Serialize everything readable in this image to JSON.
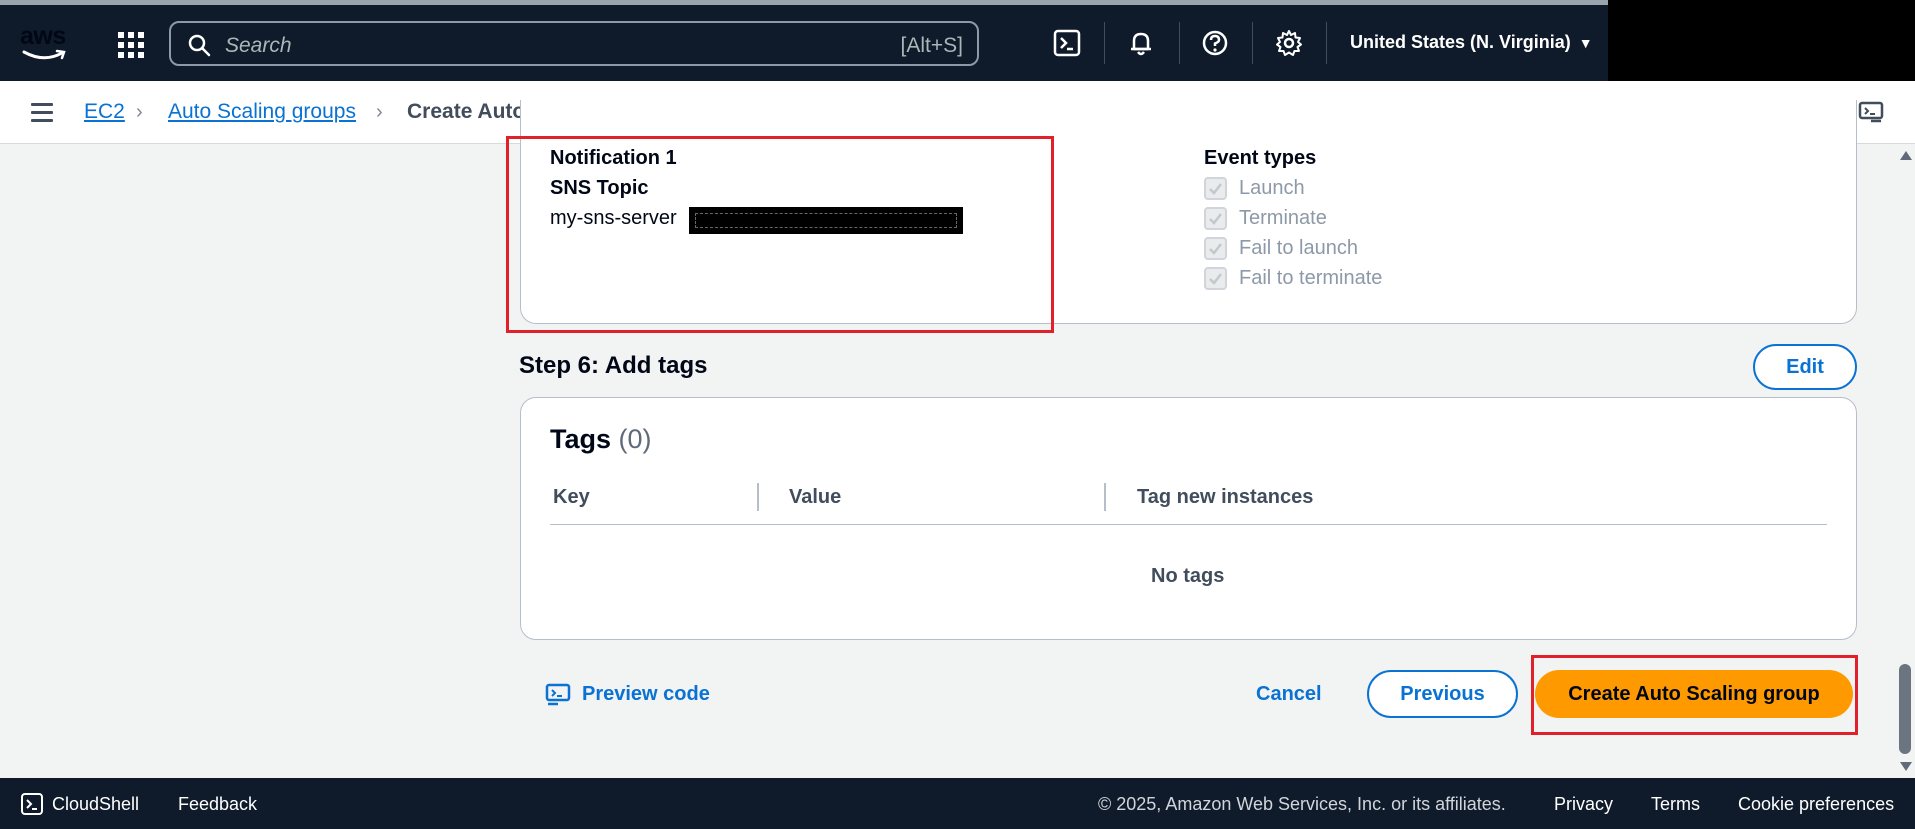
{
  "topnav": {
    "logo_text": "aws",
    "search_placeholder": "Search",
    "search_shortcut": "[Alt+S]",
    "region": "United States (N. Virginia)"
  },
  "breadcrumb": {
    "items": [
      "EC2",
      "Auto Scaling groups"
    ],
    "current": "Create Auto Scaling group"
  },
  "notification": {
    "title": "Notification 1",
    "topic_label": "SNS Topic",
    "topic_value": "my-sns-server",
    "event_types_label": "Event types",
    "events": [
      "Launch",
      "Terminate",
      "Fail to launch",
      "Fail to terminate"
    ]
  },
  "step6": {
    "title": "Step 6: Add tags",
    "edit_label": "Edit",
    "tags_title": "Tags",
    "tags_count": "(0)",
    "columns": [
      "Key",
      "Value",
      "Tag new instances"
    ],
    "empty_text": "No tags"
  },
  "actions": {
    "preview_code": "Preview code",
    "cancel": "Cancel",
    "previous": "Previous",
    "create": "Create Auto Scaling group"
  },
  "footer": {
    "cloudshell": "CloudShell",
    "feedback": "Feedback",
    "copyright": "© 2025, Amazon Web Services, Inc. or its affiliates.",
    "privacy": "Privacy",
    "terms": "Terms",
    "cookie": "Cookie preferences"
  },
  "colors": {
    "nav_bg": "#0f1b2a",
    "link": "#0972d3",
    "primary": "#ff9900",
    "highlight": "#e0202a"
  }
}
